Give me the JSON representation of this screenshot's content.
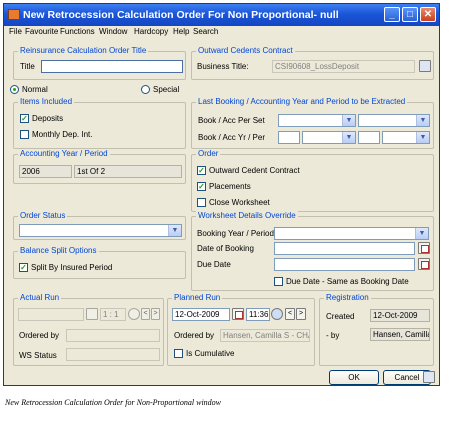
{
  "window": {
    "title": "New Retrocession Calculation Order For Non Proportional- null"
  },
  "menu": [
    "File",
    "Favourite",
    "Functions",
    "Window",
    "Hardcopy",
    "Help",
    "Search"
  ],
  "title_group": {
    "legend": "Reinsurance Calculation Order Title",
    "label": "Title",
    "value": ""
  },
  "outward_contract": {
    "legend": "Outward Cedents Contract",
    "label": "Business Title:",
    "value": "CSI90608_LossDeposit"
  },
  "mode": {
    "normal": "Normal",
    "special": "Special",
    "selected": "Normal"
  },
  "items_included": {
    "legend": "Items Included",
    "deposits": "Deposits",
    "deposits_checked": true,
    "monthly": "Monthly Dep. Int.",
    "monthly_checked": false
  },
  "last_booking": {
    "legend": "Last Booking / Accounting Year and Period to be Extracted",
    "book_acc_per_set": "Book / Acc Per Set",
    "book_acc_yr_per": "Book / Acc Yr / Per"
  },
  "accounting": {
    "legend": "Accounting Year / Period",
    "year": "2006",
    "period": "1st Of 2"
  },
  "order": {
    "legend": "Order",
    "outward_cedent_contract": "Outward Cedent Contract",
    "occ_checked": true,
    "placements": "Placements",
    "placements_checked": true,
    "close_worksheet": "Close Worksheet",
    "close_checked": false
  },
  "order_status": {
    "legend": "Order Status",
    "value": ""
  },
  "worksheet_override": {
    "legend": "Worksheet Details Override",
    "booking_year_period": "Booking Year / Period",
    "date_of_booking": "Date of Booking",
    "due_date": "Due Date",
    "due_same": "Due Date - Same as Booking Date",
    "due_same_checked": false
  },
  "balance_split": {
    "legend": "Balance Split Options",
    "label": "Split By Insured Period",
    "checked": true
  },
  "actual_run": {
    "legend": "Actual Run",
    "time": "1 : 1",
    "ordered_by": "Ordered by",
    "ws_status": "WS Status"
  },
  "planned_run": {
    "legend": "Planned Run",
    "date": "12-Oct-2009",
    "time": "11:36",
    "ordered_by_label": "Ordered by",
    "ordered_by_value": "Hansen, Camilla S - CHAN",
    "is_cumulative": "Is Cumulative",
    "cumulative_checked": false
  },
  "registration": {
    "legend": "Registration",
    "created_label": "Created",
    "created_value": "12-Oct-2009",
    "by_label": "- by",
    "by_value": "Hansen, Camilla"
  },
  "buttons": {
    "ok": "OK",
    "cancel": "Cancel"
  },
  "caption": "New Retrocession Calculation Order for Non-Proportional window"
}
